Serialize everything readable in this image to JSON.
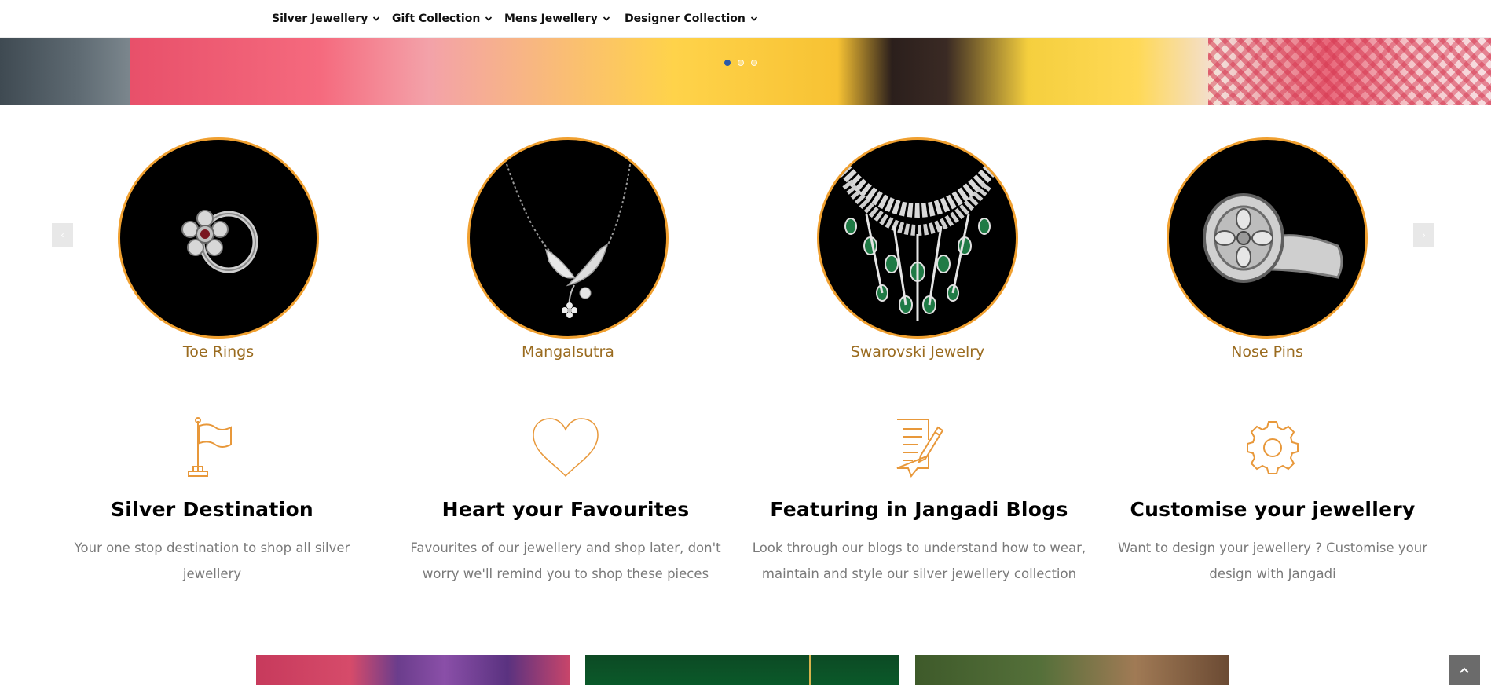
{
  "nav": {
    "items": [
      {
        "label": "Silver Jewellery"
      },
      {
        "label": "Gift Collection"
      },
      {
        "label": "Mens Jewellery"
      },
      {
        "label": "Designer Collection"
      }
    ]
  },
  "hero": {
    "slide_count": 3,
    "active_slide": 1
  },
  "categories": {
    "prev_icon": "‹",
    "next_icon": "›",
    "items": [
      {
        "label": "Toe Rings",
        "icon": "toe-ring-image"
      },
      {
        "label": "Mangalsutra",
        "icon": "mangalsutra-image"
      },
      {
        "label": "Swarovski Jewelry",
        "icon": "necklace-image"
      },
      {
        "label": "Nose Pins",
        "icon": "ring-image"
      }
    ]
  },
  "features": [
    {
      "title": "Silver Destination",
      "desc": "Your one stop destination to shop all silver jewellery",
      "icon": "flag-icon"
    },
    {
      "title": "Heart your Favourites",
      "desc": "Favourites of our jewellery and shop later, don't worry we'll remind you to shop these pieces",
      "icon": "heart-icon"
    },
    {
      "title": "Featuring in Jangadi Blogs",
      "desc": "Look through our blogs to understand how to wear, maintain and style our silver jewellery collection",
      "icon": "document-edit-icon"
    },
    {
      "title": "Customise your jewellery",
      "desc": "Want to design your jewellery ? Customise your design with Jangadi",
      "icon": "gear-icon"
    }
  ],
  "colors": {
    "accent": "#f0a030",
    "label": "#9a6b1f",
    "icon": "#e8983a",
    "active_dot": "#2b5aa8"
  }
}
